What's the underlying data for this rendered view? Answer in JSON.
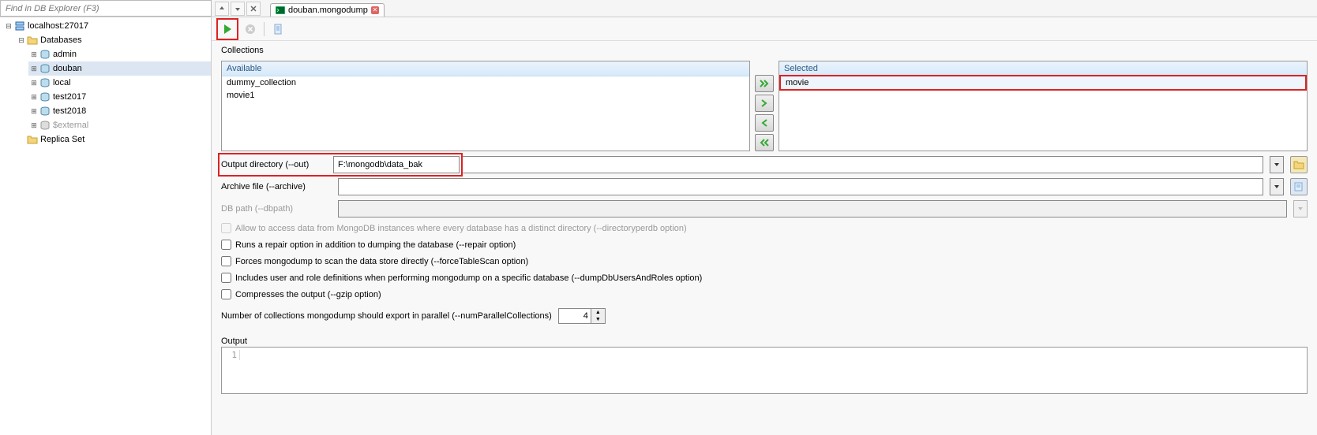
{
  "find": {
    "placeholder": "Find in DB Explorer (F3)"
  },
  "tab": {
    "title": "douban.mongodump"
  },
  "tree": {
    "root": "localhost:27017",
    "dbfolder": "Databases",
    "dbs": [
      "admin",
      "douban",
      "local",
      "test2017",
      "test2018",
      "$external"
    ],
    "selected": "douban",
    "replica": "Replica Set"
  },
  "collections": {
    "label": "Collections",
    "available_header": "Available",
    "available": [
      "dummy_collection",
      "movie1"
    ],
    "selected_header": "Selected",
    "selected": [
      "movie"
    ]
  },
  "fields": {
    "outdir_label": "Output directory (--out)",
    "outdir_value": "F:\\mongodb\\data_bak",
    "archive_label": "Archive file (--archive)",
    "archive_value": "",
    "dbpath_label": "DB path (--dbpath)",
    "dbpath_value": ""
  },
  "checks": {
    "dirperdb": "Allow to access data from MongoDB instances where every database has a distinct directory (--directoryperdb option)",
    "repair": "Runs a repair option in addition to dumping the database (--repair option)",
    "forcescan": "Forces mongodump to scan the data store directly (--forceTableScan option)",
    "dumpusers": "Includes user and role definitions when performing mongodump on a specific database (--dumpDbUsersAndRoles option)",
    "gzip": "Compresses the output (--gzip option)"
  },
  "parallel": {
    "label": "Number of collections mongodump should export in parallel (--numParallelCollections)",
    "value": "4"
  },
  "output": {
    "label": "Output",
    "line1": "1"
  }
}
